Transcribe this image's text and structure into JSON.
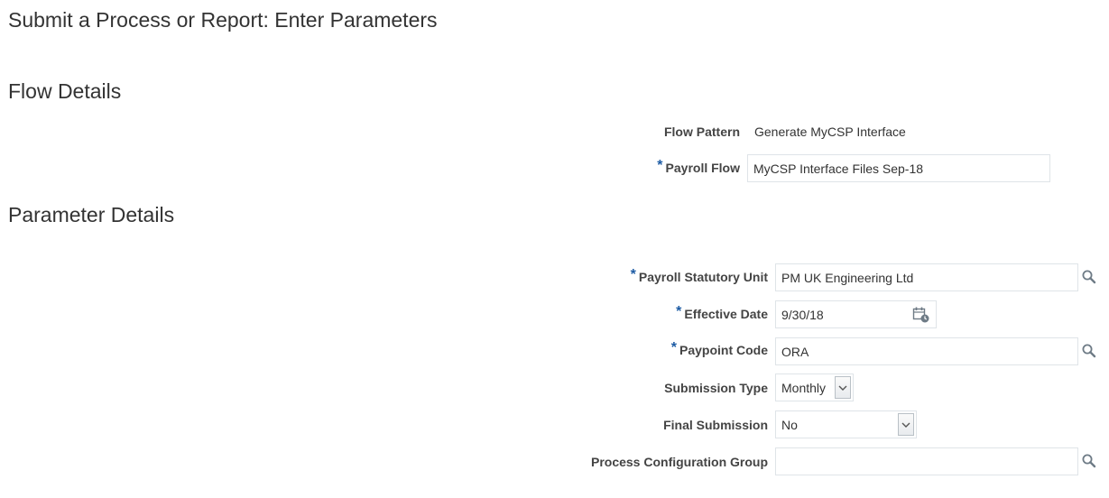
{
  "page": {
    "title": "Submit a Process or Report: Enter Parameters"
  },
  "flow_details": {
    "heading": "Flow Details",
    "flow_pattern": {
      "label": "Flow Pattern",
      "value": "Generate MyCSP Interface"
    },
    "payroll_flow": {
      "label": "Payroll Flow",
      "value": "MyCSP Interface Files Sep-18",
      "required": "*"
    }
  },
  "parameter_details": {
    "heading": "Parameter Details",
    "payroll_statutory_unit": {
      "label": "Payroll Statutory Unit",
      "value": "PM UK Engineering Ltd",
      "required": "*",
      "icon": "search-icon"
    },
    "effective_date": {
      "label": "Effective Date",
      "value": "9/30/18",
      "required": "*",
      "icon": "calendar-icon"
    },
    "paypoint_code": {
      "label": "Paypoint Code",
      "value": "ORA",
      "required": "*",
      "icon": "search-icon"
    },
    "submission_type": {
      "label": "Submission Type",
      "value": "Monthly",
      "icon": "chevron-down-icon"
    },
    "final_submission": {
      "label": "Final Submission",
      "value": "No",
      "icon": "chevron-down-icon"
    },
    "process_configuration_group": {
      "label": "Process Configuration Group",
      "value": "",
      "icon": "search-icon"
    }
  },
  "colors": {
    "required_marker": "#1c5ba4",
    "field_border": "#dfe4e8",
    "text": "#333333"
  }
}
